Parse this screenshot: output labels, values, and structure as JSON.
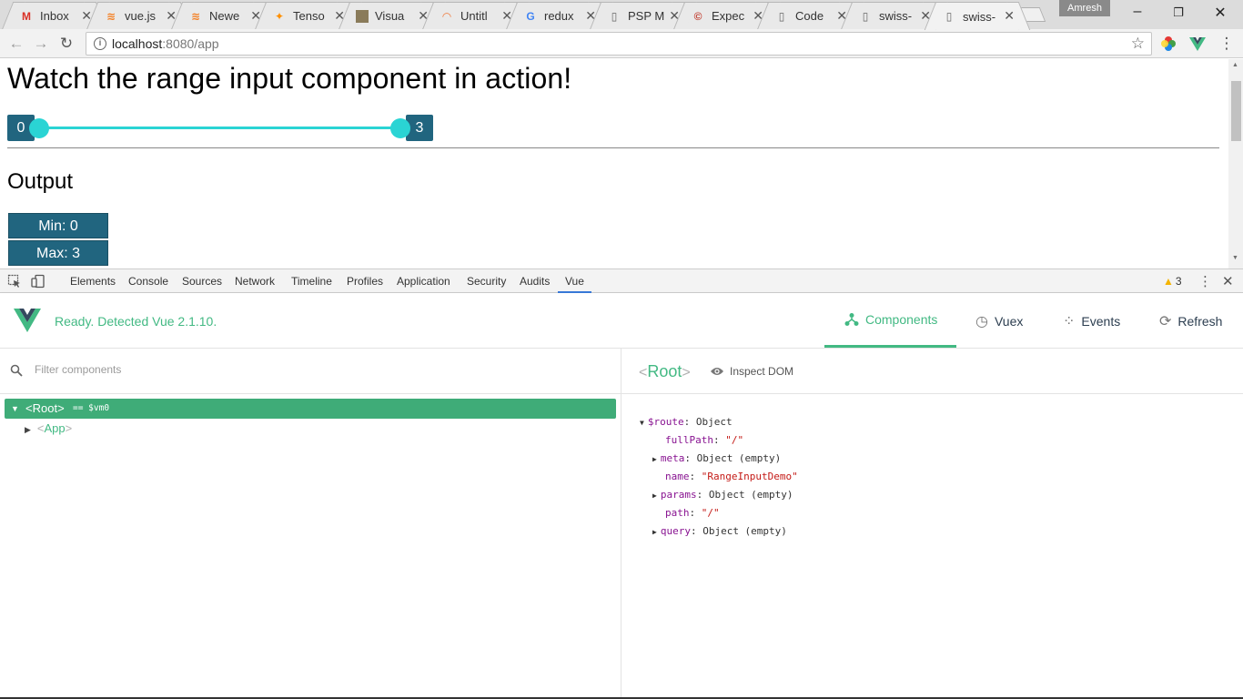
{
  "browser": {
    "tabs": [
      {
        "title": "Inbox",
        "icon": "gmail-icon"
      },
      {
        "title": "vue.js",
        "icon": "stackoverflow-icon"
      },
      {
        "title": "Newe",
        "icon": "stackoverflow-icon"
      },
      {
        "title": "Tenso",
        "icon": "tensorflow-icon"
      },
      {
        "title": "Visua",
        "icon": "image-icon"
      },
      {
        "title": "Untitl",
        "icon": "loading-icon"
      },
      {
        "title": "redux",
        "icon": "google-icon"
      },
      {
        "title": "PSP M",
        "icon": "page-icon"
      },
      {
        "title": "Expec",
        "icon": "copyright-icon"
      },
      {
        "title": "Code",
        "icon": "page-icon"
      },
      {
        "title": "swiss-",
        "icon": "page-icon"
      },
      {
        "title": "swiss-",
        "icon": "page-icon"
      }
    ],
    "profile_name": "Amresh",
    "url_host": "localhost",
    "url_path": ":8080/app"
  },
  "page": {
    "heading": "Watch the range input component in action!",
    "range": {
      "min_label": "0",
      "max_label": "3"
    },
    "output_heading": "Output",
    "min_button": "Min: 0",
    "max_button": "Max: 3"
  },
  "devtools": {
    "tabs": [
      "Elements",
      "Console",
      "Sources",
      "Network",
      "Timeline",
      "Profiles",
      "Application",
      "Security",
      "Audits",
      "Vue"
    ],
    "active_tab": "Vue",
    "warning_count": "3"
  },
  "vue": {
    "status": "Ready. Detected Vue 2.1.10.",
    "nav": {
      "components": "Components",
      "vuex": "Vuex",
      "events": "Events",
      "refresh": "Refresh"
    },
    "filter_placeholder": "Filter components",
    "tree": {
      "root_name": "Root",
      "root_vm": "== $vm0",
      "child_name": "App"
    },
    "inspect": {
      "title": "Root",
      "inspect_dom": "Inspect DOM"
    },
    "props": {
      "route_key": "$route",
      "route_val": "Object",
      "fullPath_key": "fullPath",
      "fullPath_val": "\"/\"",
      "meta_key": "meta",
      "meta_val": "Object (empty)",
      "name_key": "name",
      "name_val": "\"RangeInputDemo\"",
      "params_key": "params",
      "params_val": "Object (empty)",
      "path_key": "path",
      "path_val": "\"/\"",
      "query_key": "query",
      "query_val": "Object (empty)"
    }
  },
  "colors": {
    "vue_green": "#42b983",
    "range_teal": "#2ad4d4",
    "range_box": "#21657f",
    "tree_selected": "#3fac78"
  }
}
